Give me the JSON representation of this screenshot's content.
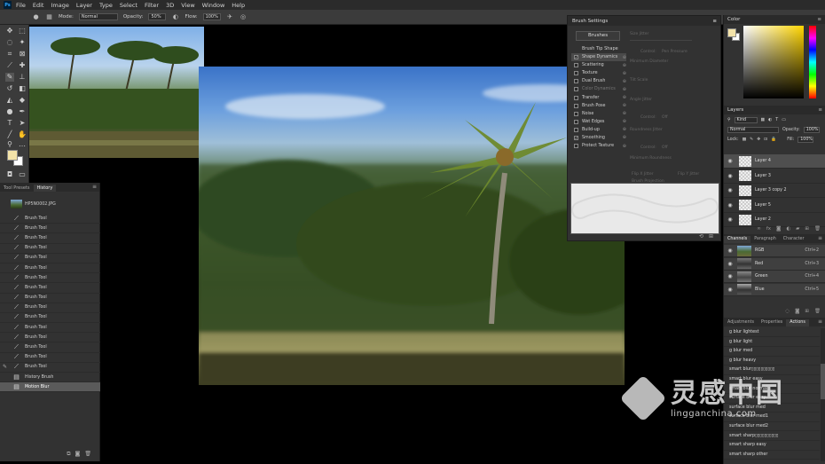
{
  "menubar": {
    "logo": "Ps",
    "items": [
      "File",
      "Edit",
      "Image",
      "Layer",
      "Type",
      "Select",
      "Filter",
      "3D",
      "View",
      "Window",
      "Help"
    ]
  },
  "options": {
    "mode_label": "Mode:",
    "mode_value": "Normal",
    "opacity_label": "Opacity:",
    "opacity_value": "50%",
    "flow_label": "Flow:",
    "flow_value": "100%"
  },
  "brush_settings": {
    "title": "Brush Settings",
    "brushes_button": "Brushes",
    "tip_shape_label": "Brush Tip Shape",
    "items": [
      {
        "label": "Shape Dynamics",
        "checked": true,
        "active": true,
        "disabled": false
      },
      {
        "label": "Scattering",
        "checked": false,
        "active": false,
        "disabled": false
      },
      {
        "label": "Texture",
        "checked": false,
        "active": false,
        "disabled": false
      },
      {
        "label": "Dual Brush",
        "checked": false,
        "active": false,
        "disabled": false
      },
      {
        "label": "Color Dynamics",
        "checked": false,
        "active": false,
        "disabled": true
      },
      {
        "label": "Transfer",
        "checked": false,
        "active": false,
        "disabled": false
      },
      {
        "label": "Brush Pose",
        "checked": false,
        "active": false,
        "disabled": false
      },
      {
        "label": "Noise",
        "checked": false,
        "active": false,
        "disabled": false
      },
      {
        "label": "Wet Edges",
        "checked": false,
        "active": false,
        "disabled": false
      },
      {
        "label": "Build-up",
        "checked": false,
        "active": false,
        "disabled": false
      },
      {
        "label": "Smoothing",
        "checked": true,
        "active": false,
        "disabled": false
      },
      {
        "label": "Protect Texture",
        "checked": false,
        "active": false,
        "disabled": false
      }
    ],
    "params": {
      "size_jitter": "Size Jitter",
      "control": "Control:",
      "control_value": "Pen Pressure",
      "minimum_diameter": "Minimum Diameter",
      "tilt_scale": "Tilt Scale",
      "angle_jitter": "Angle Jitter",
      "control2": "Control:",
      "control2_value": "Off",
      "roundness_jitter": "Roundness Jitter",
      "control3": "Control:",
      "control3_value": "Off",
      "minimum_roundness": "Minimum Roundness",
      "flip_x": "Flip X Jitter",
      "flip_y": "Flip Y Jitter",
      "brush_projection": "Brush Projection"
    }
  },
  "history": {
    "tabs": [
      "Tool Presets",
      "History"
    ],
    "active_tab": "History",
    "snapshot": "HP5N0002.JPG",
    "items": [
      {
        "label": "Brush Tool",
        "state": "normal"
      },
      {
        "label": "Brush Tool",
        "state": "normal"
      },
      {
        "label": "Brush Tool",
        "state": "normal"
      },
      {
        "label": "Brush Tool",
        "state": "normal"
      },
      {
        "label": "Brush Tool",
        "state": "normal"
      },
      {
        "label": "Brush Tool",
        "state": "normal"
      },
      {
        "label": "Brush Tool",
        "state": "normal"
      },
      {
        "label": "Brush Tool",
        "state": "normal"
      },
      {
        "label": "Brush Tool",
        "state": "normal"
      },
      {
        "label": "Brush Tool",
        "state": "normal"
      },
      {
        "label": "Brush Tool",
        "state": "normal"
      },
      {
        "label": "Brush Tool",
        "state": "normal"
      },
      {
        "label": "Brush Tool",
        "state": "normal"
      },
      {
        "label": "Brush Tool",
        "state": "normal"
      },
      {
        "label": "Brush Tool",
        "state": "normal"
      },
      {
        "label": "Brush Tool",
        "state": "normal"
      },
      {
        "label": "History Brush",
        "state": "normal"
      },
      {
        "label": "Motion Blur",
        "state": "selected"
      }
    ]
  },
  "color_panel": {
    "title": "Color",
    "foreground": "#f3e3a9",
    "background": "#ffffff"
  },
  "layers": {
    "title": "Layers",
    "kind_label": "Kind",
    "blend_mode": "Normal",
    "opacity_label": "Opacity:",
    "opacity_value": "100%",
    "lock_label": "Lock:",
    "fill_label": "Fill:",
    "fill_value": "100%",
    "items": [
      {
        "name": "Layer 4",
        "selected": true
      },
      {
        "name": "Layer 3",
        "selected": false
      },
      {
        "name": "Layer 3 copy 2",
        "selected": false
      },
      {
        "name": "Layer 5",
        "selected": false
      },
      {
        "name": "Layer 2",
        "selected": false
      }
    ]
  },
  "channels": {
    "tabs": [
      "Channels",
      "Paragraph",
      "Character"
    ],
    "items": [
      {
        "name": "RGB",
        "shortcut": "Ctrl+2"
      },
      {
        "name": "Red",
        "shortcut": "Ctrl+3"
      },
      {
        "name": "Green",
        "shortcut": "Ctrl+4"
      },
      {
        "name": "Blue",
        "shortcut": "Ctrl+5"
      }
    ]
  },
  "actions": {
    "tabs": [
      "Adjustments",
      "Properties",
      "Actions"
    ],
    "items": [
      "g blur lightest",
      "g blur light",
      "g blur med",
      "g blur heavy",
      "smart blur▯▯▯▯▯▯▯▯▯▯",
      "smart blur easy",
      "smart blur normal",
      "surface blur easy",
      "surface blur med",
      "surface blur med1",
      "surface blur med2",
      "smart sharp▯▯▯▯▯▯▯▯▯▯",
      "smart sharp easy",
      "smart sharp other"
    ]
  },
  "watermark": {
    "cn": "灵感中国",
    "en": "lingganchina.com"
  }
}
